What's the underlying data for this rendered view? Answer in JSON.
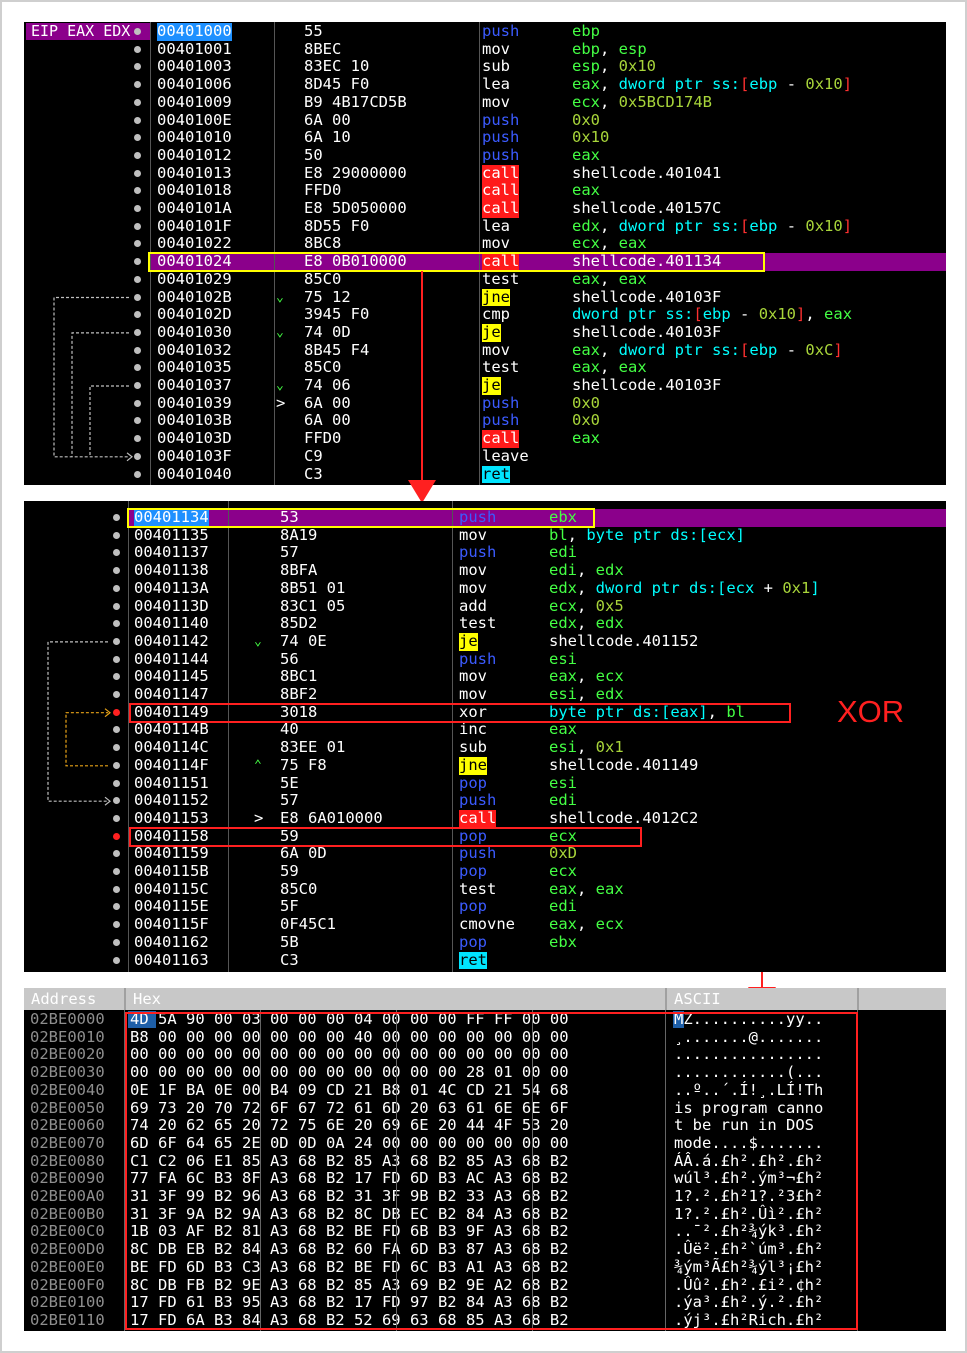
{
  "panel1": {
    "register_label": "EIP EAX EDX",
    "rows": [
      {
        "addr": "00401000",
        "bytes": "55",
        "mn": "push",
        "mt": "blue",
        "ops": [
          [
            "reg",
            "ebp"
          ]
        ]
      },
      {
        "addr": "00401001",
        "bytes": "8BEC",
        "mn": "mov",
        "mt": "white",
        "ops": [
          [
            "reg",
            "ebp"
          ],
          [
            "plain",
            ", "
          ],
          [
            "reg",
            "esp"
          ]
        ]
      },
      {
        "addr": "00401003",
        "bytes": "83EC 10",
        "mn": "sub",
        "mt": "white",
        "ops": [
          [
            "reg",
            "esp"
          ],
          [
            "plain",
            ", "
          ],
          [
            "num",
            "0x10"
          ]
        ]
      },
      {
        "addr": "00401006",
        "bytes": "8D45 F0",
        "mn": "lea",
        "mt": "white",
        "ops": [
          [
            "reg",
            "eax"
          ],
          [
            "plain",
            ", "
          ],
          [
            "kw",
            "dword ptr"
          ],
          [
            "plain",
            " "
          ],
          [
            "kw",
            "ss:"
          ],
          [
            "br",
            "["
          ],
          [
            "kw",
            "ebp"
          ],
          [
            "plain",
            " - "
          ],
          [
            "num",
            "0x10"
          ],
          [
            "br",
            "]"
          ]
        ]
      },
      {
        "addr": "00401009",
        "bytes": "B9 4B17CD5B",
        "mn": "mov",
        "mt": "white",
        "ops": [
          [
            "reg",
            "ecx"
          ],
          [
            "plain",
            ", "
          ],
          [
            "num",
            "0x5BCD174B"
          ]
        ]
      },
      {
        "addr": "0040100E",
        "bytes": "6A 00",
        "mn": "push",
        "mt": "blue",
        "ops": [
          [
            "num",
            "0x0"
          ]
        ]
      },
      {
        "addr": "00401010",
        "bytes": "6A 10",
        "mn": "push",
        "mt": "blue",
        "ops": [
          [
            "num",
            "0x10"
          ]
        ]
      },
      {
        "addr": "00401012",
        "bytes": "50",
        "mn": "push",
        "mt": "blue",
        "ops": [
          [
            "reg",
            "eax"
          ]
        ]
      },
      {
        "addr": "00401013",
        "bytes": "E8 29000000",
        "mn": "call",
        "mt": "call",
        "ops": [
          [
            "plain",
            "shellcode.401041"
          ]
        ]
      },
      {
        "addr": "00401018",
        "bytes": "FFD0",
        "mn": "call",
        "mt": "call",
        "ops": [
          [
            "reg",
            "eax"
          ]
        ]
      },
      {
        "addr": "0040101A",
        "bytes": "E8 5D050000",
        "mn": "call",
        "mt": "call",
        "ops": [
          [
            "plain",
            "shellcode.40157C"
          ]
        ]
      },
      {
        "addr": "0040101F",
        "bytes": "8D55 F0",
        "mn": "lea",
        "mt": "white",
        "ops": [
          [
            "reg",
            "edx"
          ],
          [
            "plain",
            ", "
          ],
          [
            "kw",
            "dword ptr"
          ],
          [
            "plain",
            " "
          ],
          [
            "kw",
            "ss:"
          ],
          [
            "br",
            "["
          ],
          [
            "kw",
            "ebp"
          ],
          [
            "plain",
            " - "
          ],
          [
            "num",
            "0x10"
          ],
          [
            "br",
            "]"
          ]
        ]
      },
      {
        "addr": "00401022",
        "bytes": "8BC8",
        "mn": "mov",
        "mt": "white",
        "ops": [
          [
            "reg",
            "ecx"
          ],
          [
            "plain",
            ", "
          ],
          [
            "reg",
            "eax"
          ]
        ]
      },
      {
        "addr": "00401024",
        "bytes": "E8 0B010000",
        "mn": "call",
        "mt": "call",
        "ops": [
          [
            "plain",
            "shellcode.401134"
          ]
        ]
      },
      {
        "addr": "00401029",
        "bytes": "85C0",
        "mn": "test",
        "mt": "white",
        "ops": [
          [
            "reg",
            "eax"
          ],
          [
            "plain",
            ", "
          ],
          [
            "reg",
            "eax"
          ]
        ]
      },
      {
        "addr": "0040102B",
        "bytes": "75 12",
        "mn": "jne",
        "mt": "jcc",
        "ops": [
          [
            "plain",
            "shellcode.40103F"
          ]
        ]
      },
      {
        "addr": "0040102D",
        "bytes": "3945 F0",
        "mn": "cmp",
        "mt": "white",
        "ops": [
          [
            "kw",
            "dword ptr"
          ],
          [
            "plain",
            " "
          ],
          [
            "kw",
            "ss:"
          ],
          [
            "br",
            "["
          ],
          [
            "kw",
            "ebp"
          ],
          [
            "plain",
            " - "
          ],
          [
            "num",
            "0x10"
          ],
          [
            "br",
            "]"
          ],
          [
            "plain",
            ", "
          ],
          [
            "reg",
            "eax"
          ]
        ]
      },
      {
        "addr": "00401030",
        "bytes": "74 0D",
        "mn": "je",
        "mt": "jcc",
        "ops": [
          [
            "plain",
            "shellcode.40103F"
          ]
        ]
      },
      {
        "addr": "00401032",
        "bytes": "8B45 F4",
        "mn": "mov",
        "mt": "white",
        "ops": [
          [
            "reg",
            "eax"
          ],
          [
            "plain",
            ", "
          ],
          [
            "kw",
            "dword ptr"
          ],
          [
            "plain",
            " "
          ],
          [
            "kw",
            "ss:"
          ],
          [
            "br",
            "["
          ],
          [
            "kw",
            "ebp"
          ],
          [
            "plain",
            " - "
          ],
          [
            "num",
            "0xC"
          ],
          [
            "br",
            "]"
          ]
        ]
      },
      {
        "addr": "00401035",
        "bytes": "85C0",
        "mn": "test",
        "mt": "white",
        "ops": [
          [
            "reg",
            "eax"
          ],
          [
            "plain",
            ", "
          ],
          [
            "reg",
            "eax"
          ]
        ]
      },
      {
        "addr": "00401037",
        "bytes": "74 06",
        "mn": "je",
        "mt": "jcc",
        "ops": [
          [
            "plain",
            "shellcode.40103F"
          ]
        ]
      },
      {
        "addr": "00401039",
        "bytes": "6A 00",
        "mn": "push",
        "mt": "blue",
        "ops": [
          [
            "num",
            "0x0"
          ]
        ]
      },
      {
        "addr": "0040103B",
        "bytes": "6A 00",
        "mn": "push",
        "mt": "blue",
        "ops": [
          [
            "num",
            "0x0"
          ]
        ]
      },
      {
        "addr": "0040103D",
        "bytes": "FFD0",
        "mn": "call",
        "mt": "call",
        "ops": [
          [
            "reg",
            "eax"
          ]
        ]
      },
      {
        "addr": "0040103F",
        "bytes": "C9",
        "mn": "leave",
        "mt": "white",
        "ops": []
      },
      {
        "addr": "00401040",
        "bytes": "C3",
        "mn": "ret",
        "mt": "ret",
        "ops": []
      }
    ]
  },
  "panel2": {
    "annotation": "XOR",
    "rows": [
      {
        "addr": "00401134",
        "bytes": "53",
        "mn": "push",
        "mt": "blue",
        "ops": [
          [
            "reg",
            "ebx"
          ]
        ]
      },
      {
        "addr": "00401135",
        "bytes": "8A19",
        "mn": "mov",
        "mt": "white",
        "ops": [
          [
            "reg",
            "bl"
          ],
          [
            "plain",
            ", "
          ],
          [
            "kw",
            "byte ptr"
          ],
          [
            "plain",
            " "
          ],
          [
            "kw",
            "ds:[ecx]"
          ]
        ]
      },
      {
        "addr": "00401137",
        "bytes": "57",
        "mn": "push",
        "mt": "blue",
        "ops": [
          [
            "reg",
            "edi"
          ]
        ]
      },
      {
        "addr": "00401138",
        "bytes": "8BFA",
        "mn": "mov",
        "mt": "white",
        "ops": [
          [
            "reg",
            "edi"
          ],
          [
            "plain",
            ", "
          ],
          [
            "reg",
            "edx"
          ]
        ]
      },
      {
        "addr": "0040113A",
        "bytes": "8B51 01",
        "mn": "mov",
        "mt": "white",
        "ops": [
          [
            "reg",
            "edx"
          ],
          [
            "plain",
            ", "
          ],
          [
            "kw",
            "dword ptr"
          ],
          [
            "plain",
            " "
          ],
          [
            "kw",
            "ds:[ecx"
          ],
          [
            "plain",
            " + "
          ],
          [
            "num",
            "0x1"
          ],
          [
            "kw",
            "]"
          ]
        ]
      },
      {
        "addr": "0040113D",
        "bytes": "83C1 05",
        "mn": "add",
        "mt": "white",
        "ops": [
          [
            "reg",
            "ecx"
          ],
          [
            "plain",
            ", "
          ],
          [
            "num",
            "0x5"
          ]
        ]
      },
      {
        "addr": "00401140",
        "bytes": "85D2",
        "mn": "test",
        "mt": "white",
        "ops": [
          [
            "reg",
            "edx"
          ],
          [
            "plain",
            ", "
          ],
          [
            "reg",
            "edx"
          ]
        ]
      },
      {
        "addr": "00401142",
        "bytes": "74 0E",
        "mn": "je",
        "mt": "jcc",
        "ops": [
          [
            "plain",
            "shellcode.401152"
          ]
        ]
      },
      {
        "addr": "00401144",
        "bytes": "56",
        "mn": "push",
        "mt": "blue",
        "ops": [
          [
            "reg",
            "esi"
          ]
        ]
      },
      {
        "addr": "00401145",
        "bytes": "8BC1",
        "mn": "mov",
        "mt": "white",
        "ops": [
          [
            "reg",
            "eax"
          ],
          [
            "plain",
            ", "
          ],
          [
            "reg",
            "ecx"
          ]
        ]
      },
      {
        "addr": "00401147",
        "bytes": "8BF2",
        "mn": "mov",
        "mt": "white",
        "ops": [
          [
            "reg",
            "esi"
          ],
          [
            "plain",
            ", "
          ],
          [
            "reg",
            "edx"
          ]
        ]
      },
      {
        "addr": "00401149",
        "bytes": "3018",
        "mn": "xor",
        "mt": "white",
        "ops": [
          [
            "kw",
            "byte ptr"
          ],
          [
            "plain",
            " "
          ],
          [
            "kw",
            "ds:[eax]"
          ],
          [
            "plain",
            ", "
          ],
          [
            "reg",
            "bl"
          ]
        ]
      },
      {
        "addr": "0040114B",
        "bytes": "40",
        "mn": "inc",
        "mt": "white",
        "ops": [
          [
            "reg",
            "eax"
          ]
        ]
      },
      {
        "addr": "0040114C",
        "bytes": "83EE 01",
        "mn": "sub",
        "mt": "white",
        "ops": [
          [
            "reg",
            "esi"
          ],
          [
            "plain",
            ", "
          ],
          [
            "num",
            "0x1"
          ]
        ]
      },
      {
        "addr": "0040114F",
        "bytes": "75 F8",
        "mn": "jne",
        "mt": "jcc",
        "ops": [
          [
            "plain",
            "shellcode.401149"
          ]
        ]
      },
      {
        "addr": "00401151",
        "bytes": "5E",
        "mn": "pop",
        "mt": "blue",
        "ops": [
          [
            "reg",
            "esi"
          ]
        ]
      },
      {
        "addr": "00401152",
        "bytes": "57",
        "mn": "push",
        "mt": "blue",
        "ops": [
          [
            "reg",
            "edi"
          ]
        ]
      },
      {
        "addr": "00401153",
        "bytes": "E8 6A010000",
        "mn": "call",
        "mt": "call",
        "ops": [
          [
            "plain",
            "shellcode.4012C2"
          ]
        ]
      },
      {
        "addr": "00401158",
        "bytes": "59",
        "mn": "pop",
        "mt": "blue",
        "ops": [
          [
            "reg",
            "ecx"
          ]
        ]
      },
      {
        "addr": "00401159",
        "bytes": "6A 0D",
        "mn": "push",
        "mt": "blue",
        "ops": [
          [
            "num",
            "0xD"
          ]
        ]
      },
      {
        "addr": "0040115B",
        "bytes": "59",
        "mn": "pop",
        "mt": "blue",
        "ops": [
          [
            "reg",
            "ecx"
          ]
        ]
      },
      {
        "addr": "0040115C",
        "bytes": "85C0",
        "mn": "test",
        "mt": "white",
        "ops": [
          [
            "reg",
            "eax"
          ],
          [
            "plain",
            ", "
          ],
          [
            "reg",
            "eax"
          ]
        ]
      },
      {
        "addr": "0040115E",
        "bytes": "5F",
        "mn": "pop",
        "mt": "blue",
        "ops": [
          [
            "reg",
            "edi"
          ]
        ]
      },
      {
        "addr": "0040115F",
        "bytes": "0F45C1",
        "mn": "cmovne",
        "mt": "white",
        "ops": [
          [
            "reg",
            "eax"
          ],
          [
            "plain",
            ", "
          ],
          [
            "reg",
            "ecx"
          ]
        ]
      },
      {
        "addr": "00401162",
        "bytes": "5B",
        "mn": "pop",
        "mt": "blue",
        "ops": [
          [
            "reg",
            "ebx"
          ]
        ]
      },
      {
        "addr": "00401163",
        "bytes": "C3",
        "mn": "ret",
        "mt": "ret",
        "ops": []
      }
    ]
  },
  "dump": {
    "headers": {
      "address": "Address",
      "hex": "Hex",
      "ascii": "ASCII"
    },
    "rows": [
      {
        "addr": "02BE0000",
        "hex": "4D 5A 90 00 03 00 00 00 04 00 00 00 FF FF 00 00",
        "ascii": "MZ..........ÿÿ.."
      },
      {
        "addr": "02BE0010",
        "hex": "B8 00 00 00 00 00 00 00 40 00 00 00 00 00 00 00",
        "ascii": "¸.......@......."
      },
      {
        "addr": "02BE0020",
        "hex": "00 00 00 00 00 00 00 00 00 00 00 00 00 00 00 00",
        "ascii": "................"
      },
      {
        "addr": "02BE0030",
        "hex": "00 00 00 00 00 00 00 00 00 00 00 00 28 01 00 00",
        "ascii": "............(..."
      },
      {
        "addr": "02BE0040",
        "hex": "0E 1F BA 0E 00 B4 09 CD 21 B8 01 4C CD 21 54 68",
        "ascii": "..º..´.Í!¸.LÍ!Th"
      },
      {
        "addr": "02BE0050",
        "hex": "69 73 20 70 72 6F 67 72 61 6D 20 63 61 6E 6E 6F",
        "ascii": "is program canno"
      },
      {
        "addr": "02BE0060",
        "hex": "74 20 62 65 20 72 75 6E 20 69 6E 20 44 4F 53 20",
        "ascii": "t be run in DOS "
      },
      {
        "addr": "02BE0070",
        "hex": "6D 6F 64 65 2E 0D 0D 0A 24 00 00 00 00 00 00 00",
        "ascii": "mode....$......."
      },
      {
        "addr": "02BE0080",
        "hex": "C1 C2 06 E1 85 A3 68 B2 85 A3 68 B2 85 A3 68 B2",
        "ascii": "ÁÂ.á.£h².£h².£h²"
      },
      {
        "addr": "02BE0090",
        "hex": "77 FA 6C B3 8F A3 68 B2 17 FD 6D B3 AC A3 68 B2",
        "ascii": "wúl³.£h².ým³¬£h²"
      },
      {
        "addr": "02BE00A0",
        "hex": "31 3F 99 B2 96 A3 68 B2 31 3F 9B B2 33 A3 68 B2",
        "ascii": "1?.².£h²1?.²3£h²"
      },
      {
        "addr": "02BE00B0",
        "hex": "31 3F 9A B2 9A A3 68 B2 8C DB EC B2 84 A3 68 B2",
        "ascii": "1?.².£h².Ûì².£h²"
      },
      {
        "addr": "02BE00C0",
        "hex": "1B 03 AF B2 81 A3 68 B2 BE FD 6B B3 9F A3 68 B2",
        "ascii": "..¯².£h²¾ýk³.£h²"
      },
      {
        "addr": "02BE00D0",
        "hex": "8C DB EB B2 84 A3 68 B2 60 FA 6D B3 87 A3 68 B2",
        "ascii": ".Ûë².£h²`úm³.£h²"
      },
      {
        "addr": "02BE00E0",
        "hex": "BE FD 6D B3 C3 A3 68 B2 BE FD 6C B3 A1 A3 68 B2",
        "ascii": "¾ým³Ã£h²¾ýl³¡£h²"
      },
      {
        "addr": "02BE00F0",
        "hex": "8C DB FB B2 9E A3 68 B2 85 A3 69 B2 9E A2 68 B2",
        "ascii": ".Ûû².£h².£i².¢h²"
      },
      {
        "addr": "02BE0100",
        "hex": "17 FD 61 B3 95 A3 68 B2 17 FD 97 B2 84 A3 68 B2",
        "ascii": ".ýa³.£h².ý.².£h²"
      },
      {
        "addr": "02BE0110",
        "hex": "17 FD 6A B3 84 A3 68 B2 52 69 63 68 85 A3 68 B2",
        "ascii": ".ýj³.£h²Rich.£h²"
      }
    ]
  }
}
